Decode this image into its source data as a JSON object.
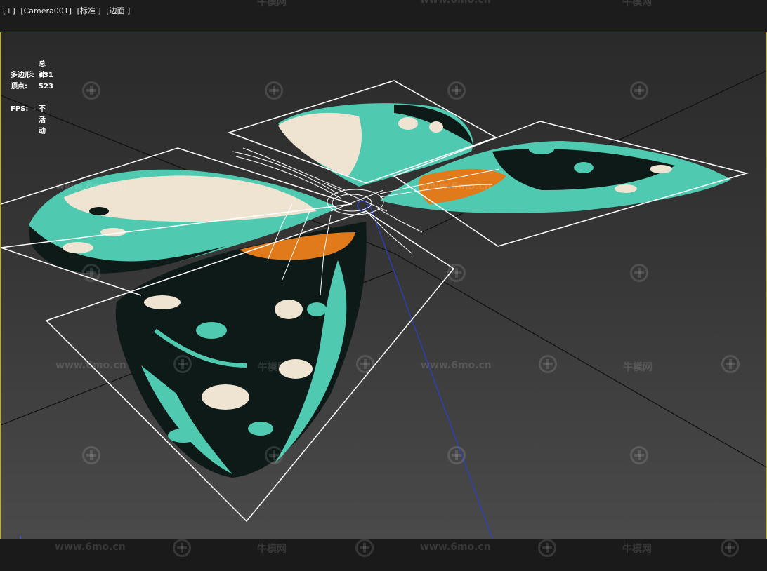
{
  "viewport": {
    "labels": [
      "[+]",
      "[Camera001]",
      "[标准 ]",
      "[边面 ]"
    ]
  },
  "stats": {
    "header": "总计",
    "polygons_label": "多边形:",
    "polygons_value": "431",
    "vertices_label": "顶点:",
    "vertices_value": "523",
    "fps_label": "FPS:",
    "fps_value": "不活动"
  },
  "watermark": {
    "url": "www.6mo.cn",
    "brand": "牛模网"
  },
  "colors": {
    "viewport_border": "#c8b400",
    "wing_teal": "#4fc9b0",
    "wing_orange": "#e07a1a",
    "wing_cream": "#efe3d2",
    "wireframe": "#ffffff"
  },
  "gizmo": {
    "axes": [
      "x",
      "y",
      "z"
    ]
  }
}
